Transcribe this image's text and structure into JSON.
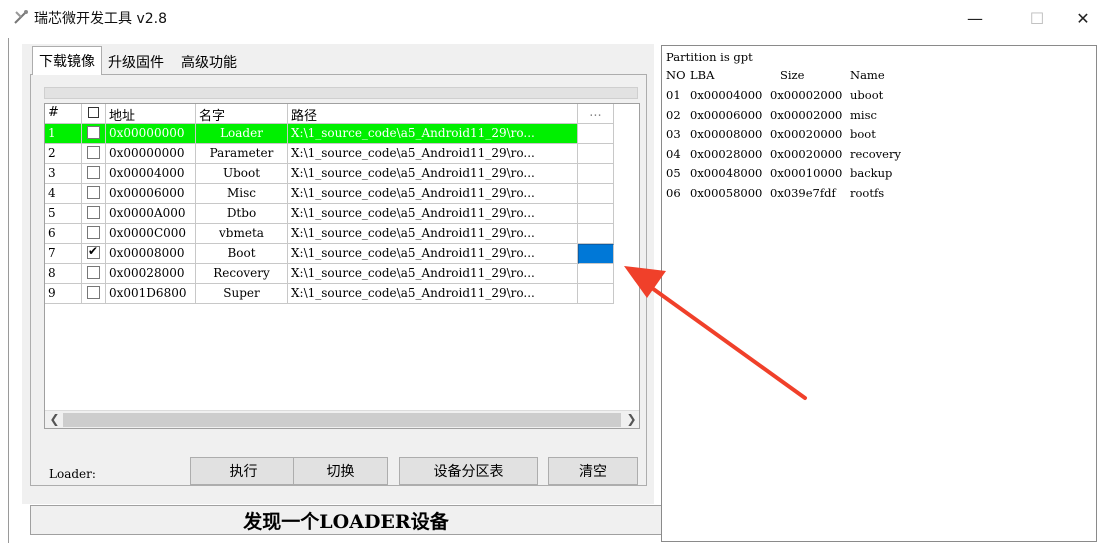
{
  "window": {
    "title": "瑞芯微开发工具 v2.8",
    "minimize": "—",
    "maximize": "☐",
    "close": "✕"
  },
  "tabs": [
    {
      "label": "下载镜像"
    },
    {
      "label": "升级固件"
    },
    {
      "label": "高级功能"
    }
  ],
  "table": {
    "headers": {
      "num": "#",
      "addr": "地址",
      "name": "名字",
      "path": "路径",
      "btn": "..."
    },
    "rows": [
      {
        "num": "1",
        "checked": false,
        "addr": "0x00000000",
        "name": "Loader",
        "path": "X:\\1_source_code\\a5_Android11_29\\ro...",
        "selected": true
      },
      {
        "num": "2",
        "checked": false,
        "addr": "0x00000000",
        "name": "Parameter",
        "path": "X:\\1_source_code\\a5_Android11_29\\ro..."
      },
      {
        "num": "3",
        "checked": false,
        "addr": "0x00004000",
        "name": "Uboot",
        "path": "X:\\1_source_code\\a5_Android11_29\\ro..."
      },
      {
        "num": "4",
        "checked": false,
        "addr": "0x00006000",
        "name": "Misc",
        "path": "X:\\1_source_code\\a5_Android11_29\\ro..."
      },
      {
        "num": "5",
        "checked": false,
        "addr": "0x0000A000",
        "name": "Dtbo",
        "path": "X:\\1_source_code\\a5_Android11_29\\ro..."
      },
      {
        "num": "6",
        "checked": false,
        "addr": "0x0000C000",
        "name": "vbmeta",
        "path": "X:\\1_source_code\\a5_Android11_29\\ro..."
      },
      {
        "num": "7",
        "checked": true,
        "addr": "0x00008000",
        "name": "Boot",
        "path": "X:\\1_source_code\\a5_Android11_29\\ro..."
      },
      {
        "num": "8",
        "checked": false,
        "addr": "0x00028000",
        "name": "Recovery",
        "path": "X:\\1_source_code\\a5_Android11_29\\ro..."
      },
      {
        "num": "9",
        "checked": false,
        "addr": "0x001D6800",
        "name": "Super",
        "path": "X:\\1_source_code\\a5_Android11_29\\ro..."
      }
    ]
  },
  "loader_label": "Loader:",
  "buttons": {
    "execute": "执行",
    "switch": "切换",
    "partition_table": "设备分区表",
    "clear": "清空"
  },
  "status": "发现一个LOADER设备",
  "partition_panel": {
    "title": "Partition is gpt",
    "headers": {
      "no": "NO",
      "lba": "LBA",
      "size": "Size",
      "name": "Name"
    },
    "rows": [
      {
        "no": "01",
        "lba": "0x00004000",
        "size": "0x00002000",
        "name": "uboot"
      },
      {
        "no": "02",
        "lba": "0x00006000",
        "size": "0x00002000",
        "name": "misc"
      },
      {
        "no": "03",
        "lba": "0x00008000",
        "size": "0x00020000",
        "name": "boot"
      },
      {
        "no": "04",
        "lba": "0x00028000",
        "size": "0x00020000",
        "name": "recovery"
      },
      {
        "no": "05",
        "lba": "0x00048000",
        "size": "0x00010000",
        "name": "backup"
      },
      {
        "no": "06",
        "lba": "0x00058000",
        "size": "0x039e7fdf",
        "name": "rootfs"
      }
    ]
  },
  "colors": {
    "selected_row": "#00f000",
    "active_cell": "#0078d7",
    "annotation_arrow": "#f0402a"
  }
}
